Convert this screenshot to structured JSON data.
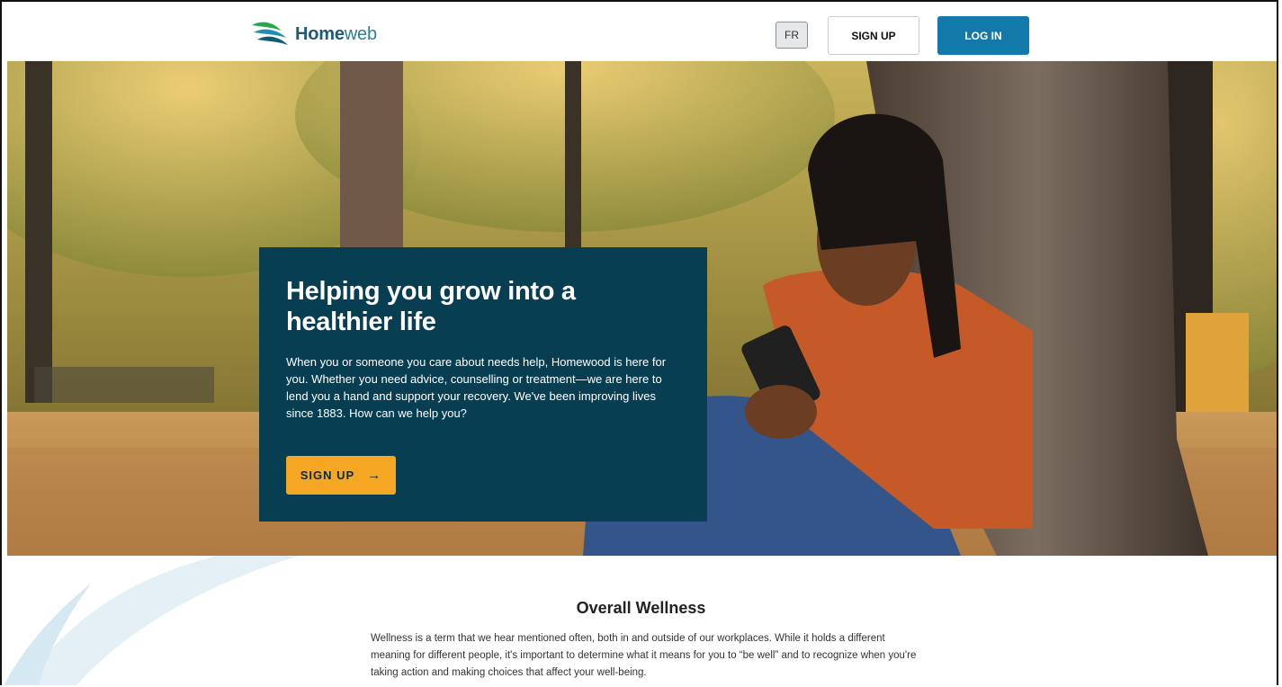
{
  "header": {
    "logo_bold": "Home",
    "logo_light": "web",
    "lang_button": "FR",
    "signup_label": "SIGN UP",
    "login_label": "LOG IN"
  },
  "hero": {
    "title": "Helping you grow into a healthier life",
    "body": "When you or someone you care about needs help, Homewood is here for you. Whether you need advice, counselling or treatment—we are here to lend you a hand and support your recovery. We've been improving lives since 1883. How can we help you?",
    "cta_label": "SIGN UP",
    "cta_icon": "arrow-right-icon"
  },
  "wellness": {
    "title": "Overall Wellness",
    "text": "Wellness is a term that we hear mentioned often, both in and outside of our workplaces. While it holds a different meaning for different people, it's important to determine what it means for you to “be well” and to recognize when you're taking action and making choices that affect your well-being."
  },
  "colors": {
    "brand_dark": "#073e52",
    "brand_blue": "#1379a8",
    "accent_orange": "#f5a623"
  }
}
